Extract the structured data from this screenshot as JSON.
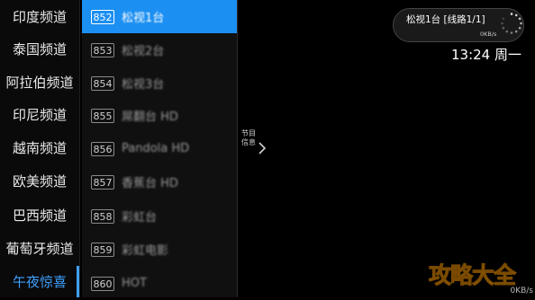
{
  "categories": [
    {
      "label": "印度频道"
    },
    {
      "label": "泰国频道"
    },
    {
      "label": "阿拉伯频道"
    },
    {
      "label": "印尼频道"
    },
    {
      "label": "越南频道"
    },
    {
      "label": "欧美频道"
    },
    {
      "label": "巴西频道"
    },
    {
      "label": "葡萄牙频道"
    },
    {
      "label": "午夜惊喜"
    }
  ],
  "active_category": "午夜惊喜",
  "channels": [
    {
      "number": "852",
      "name": "松视1台"
    },
    {
      "number": "853",
      "name": "松视2台"
    },
    {
      "number": "854",
      "name": "松视3台"
    },
    {
      "number": "855",
      "name": "屌翻台 HD"
    },
    {
      "number": "856",
      "name": "Pandola HD"
    },
    {
      "number": "857",
      "name": "香蕉台 HD"
    },
    {
      "number": "858",
      "name": "彩虹台"
    },
    {
      "number": "859",
      "name": "彩虹电影"
    },
    {
      "number": "860",
      "name": "HOT"
    }
  ],
  "active_channel": "852",
  "program_info": {
    "label": "节目信息"
  },
  "status": {
    "channel_line": "松视1台 [线路1/1]",
    "speed": "0KB/s"
  },
  "clock": {
    "time_day": "13:24 周一"
  },
  "bottom_speed": "0KB/s",
  "watermark": "攻略大全",
  "colors": {
    "accent": "#1b8ff2",
    "active_text": "#3ea0ff",
    "watermark": "#f1b700"
  }
}
